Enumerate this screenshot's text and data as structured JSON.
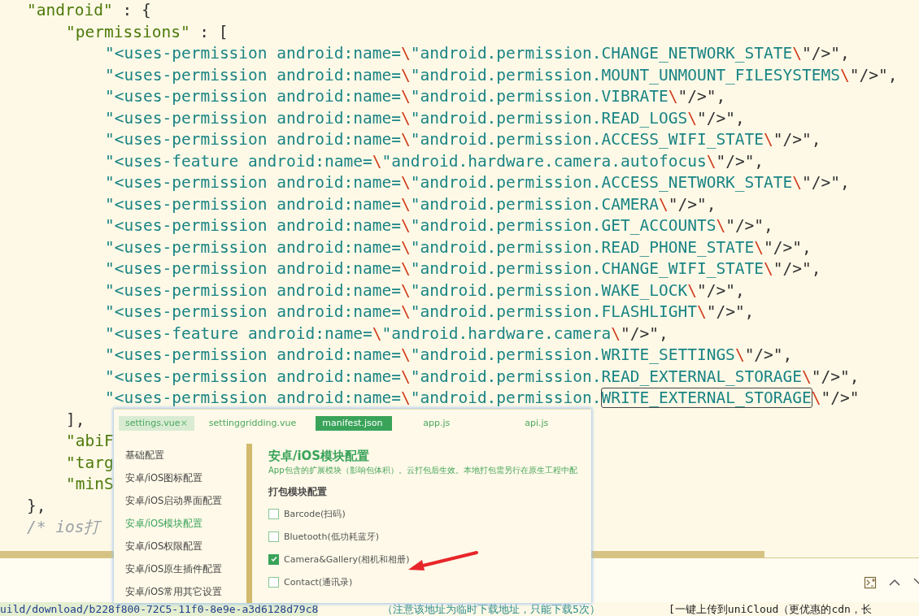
{
  "editor": {
    "code": [
      {
        "kind": "key",
        "key": "\"android\"",
        "rest": " : {",
        "children": [
          {
            "kind": "key",
            "key": "\"permissions\"",
            "rest": " : [",
            "children": [
              {
                "kind": "string",
                "text": "\"<uses-permission android:name=\\\"android.permission.CHANGE_NETWORK_STATE\\\"/>\","
              },
              {
                "kind": "string",
                "text": "\"<uses-permission android:name=\\\"android.permission.MOUNT_UNMOUNT_FILESYSTEMS\\\"/>\","
              },
              {
                "kind": "string",
                "text": "\"<uses-permission android:name=\\\"android.permission.VIBRATE\\\"/>\","
              },
              {
                "kind": "string",
                "text": "\"<uses-permission android:name=\\\"android.permission.READ_LOGS\\\"/>\","
              },
              {
                "kind": "string",
                "text": "\"<uses-permission android:name=\\\"android.permission.ACCESS_WIFI_STATE\\\"/>\","
              },
              {
                "kind": "string",
                "text": "\"<uses-feature android:name=\\\"android.hardware.camera.autofocus\\\"/>\","
              },
              {
                "kind": "string",
                "text": "\"<uses-permission android:name=\\\"android.permission.ACCESS_NETWORK_STATE\\\"/>\","
              },
              {
                "kind": "string",
                "text": "\"<uses-permission android:name=\\\"android.permission.CAMERA\\\"/>\","
              },
              {
                "kind": "string",
                "text": "\"<uses-permission android:name=\\\"android.permission.GET_ACCOUNTS\\\"/>\","
              },
              {
                "kind": "string",
                "text": "\"<uses-permission android:name=\\\"android.permission.READ_PHONE_STATE\\\"/>\","
              },
              {
                "kind": "string",
                "text": "\"<uses-permission android:name=\\\"android.permission.CHANGE_WIFI_STATE\\\"/>\","
              },
              {
                "kind": "string",
                "text": "\"<uses-permission android:name=\\\"android.permission.WAKE_LOCK\\\"/>\","
              },
              {
                "kind": "string",
                "text": "\"<uses-permission android:name=\\\"android.permission.FLASHLIGHT\\\"/>\","
              },
              {
                "kind": "string",
                "text": "\"<uses-feature android:name=\\\"android.hardware.camera\\\"/>\","
              },
              {
                "kind": "string",
                "text": "\"<uses-permission android:name=\\\"android.permission.WRITE_SETTINGS\\\"/>\","
              },
              {
                "kind": "string",
                "text": "\"<uses-permission android:name=\\\"android.permission.READ_EXTERNAL_STORAGE\\\"/>\","
              },
              {
                "kind": "string",
                "text": "\"<uses-permission android:name=\\\"android.permission.",
                "match": "WRITE_EXTERNAL_STORAGE",
                "post": "\\\"/>\""
              }
            ]
          },
          {
            "kind": "punct",
            "text": "],"
          },
          {
            "kind": "key",
            "key": "\"abiF"
          },
          {
            "kind": "key",
            "key": "\"targ"
          },
          {
            "kind": "key",
            "key": "\"minS"
          }
        ]
      },
      {
        "kind": "punct",
        "text": "},"
      },
      {
        "kind": "comment",
        "text": "/* ios打"
      }
    ]
  },
  "console": {
    "output": [
      "uild/download/b228f800-72C5-11f0-8e9e-a3d6128d79c8",
      "（注意该地址为临时下载地址，只能下载5次）",
      "[一键上传到uniCloud（更优惠的cdn，长"
    ]
  },
  "inset": {
    "tabs": [
      {
        "label": "settings.vue",
        "selected": false,
        "closable": true,
        "close": "×"
      },
      {
        "label": "settinggridding.vue",
        "selected": false,
        "closable": false
      },
      {
        "label": "manifest.json",
        "selected": true,
        "closable": false
      },
      {
        "label": "app.js",
        "selected": false,
        "closable": false
      },
      {
        "label": "api.js",
        "selected": false,
        "closable": false
      }
    ],
    "nav": [
      {
        "label": "基础配置",
        "selected": false
      },
      {
        "label": "安卓/iOS图标配置",
        "selected": false
      },
      {
        "label": "安卓/iOS启动界面配置",
        "selected": false
      },
      {
        "label": "安卓/iOS模块配置",
        "selected": true
      },
      {
        "label": "安卓/iOS权限配置",
        "selected": false
      },
      {
        "label": "安卓/iOS原生插件配置",
        "selected": false
      },
      {
        "label": "安卓/iOS常用其它设置",
        "selected": false
      }
    ],
    "title": "安卓/iOS模块配置",
    "description": "App包含的扩展模块（影响包体积）。云打包后生效。本地打包需另行在原生工程中配",
    "section": "打包模块配置",
    "modules": [
      {
        "label": "Barcode(扫码)",
        "checked": false
      },
      {
        "label": "Bluetooth(低功耗蓝牙)",
        "checked": false
      },
      {
        "label": "Camera&Gallery(相机和相册)",
        "checked": true
      },
      {
        "label": "Contact(通讯录)",
        "checked": false
      }
    ]
  }
}
